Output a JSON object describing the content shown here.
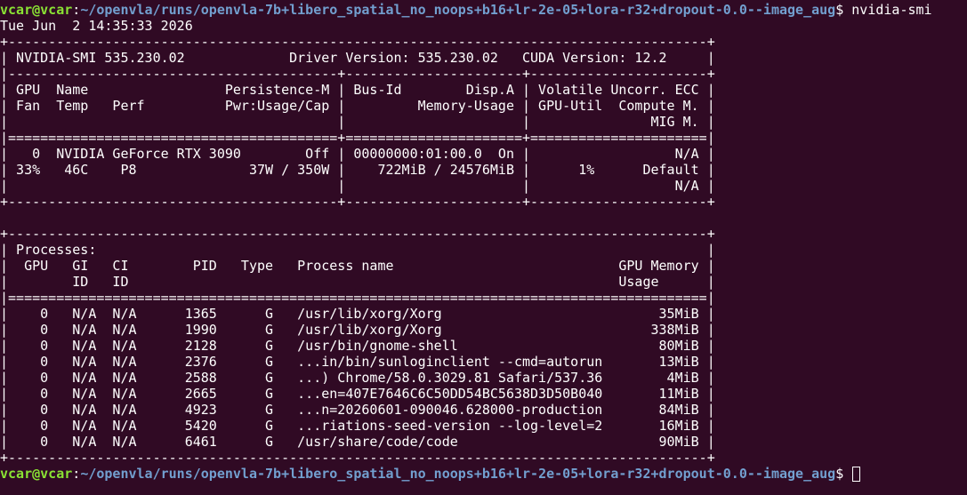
{
  "terminal": {
    "background": "#300a24",
    "prompt_user_color": "#8ae234",
    "prompt_path_color": "#729fcf",
    "prompt_user": "vcar@vcar",
    "prompt_path": "~/openvla/runs/openvla-7b+libero_spatial_no_noops+b16+lr-2e-05+lora-r32+dropout-0.0--image_aug",
    "prompt_symbol": "$",
    "command": " nvidia-smi",
    "date_line": "Tue Jun  2 14:35:33 2026"
  },
  "output_lines": [
    "+---------------------------------------------------------------------------------------+",
    "| NVIDIA-SMI 535.230.02             Driver Version: 535.230.02   CUDA Version: 12.2     |",
    "|-----------------------------------------+----------------------+----------------------+",
    "| GPU  Name                 Persistence-M | Bus-Id        Disp.A | Volatile Uncorr. ECC |",
    "| Fan  Temp   Perf          Pwr:Usage/Cap |         Memory-Usage | GPU-Util  Compute M. |",
    "|                                         |                      |               MIG M. |",
    "|=========================================+======================+======================|",
    "|   0  NVIDIA GeForce RTX 3090        Off | 00000000:01:00.0  On |                  N/A |",
    "| 33%   46C    P8              37W / 350W |    722MiB / 24576MiB |      1%      Default |",
    "|                                         |                      |                  N/A |",
    "+-----------------------------------------+----------------------+----------------------+",
    "",
    "+---------------------------------------------------------------------------------------+",
    "| Processes:                                                                            |",
    "|  GPU   GI   CI        PID   Type   Process name                            GPU Memory |",
    "|        ID   ID                                                             Usage      |",
    "|=======================================================================================|",
    "|    0   N/A  N/A      1365      G   /usr/lib/xorg/Xorg                           35MiB |",
    "|    0   N/A  N/A      1990      G   /usr/lib/xorg/Xorg                          338MiB |",
    "|    0   N/A  N/A      2128      G   /usr/bin/gnome-shell                         80MiB |",
    "|    0   N/A  N/A      2376      G   ...in/bin/sunloginclient --cmd=autorun       13MiB |",
    "|    0   N/A  N/A      2588      G   ...) Chrome/58.0.3029.81 Safari/537.36        4MiB |",
    "|    0   N/A  N/A      2665      G   ...en=407E7646C6C50DD54BC5638D3D50B040       11MiB |",
    "|    0   N/A  N/A      4923      G   ...n=20260601-090046.628000-production       84MiB |",
    "|    0   N/A  N/A      5420      G   ...riations-seed-version --log-level=2       16MiB |",
    "|    0   N/A  N/A      6461      G   /usr/share/code/code                         90MiB |",
    "+---------------------------------------------------------------------------------------+"
  ]
}
